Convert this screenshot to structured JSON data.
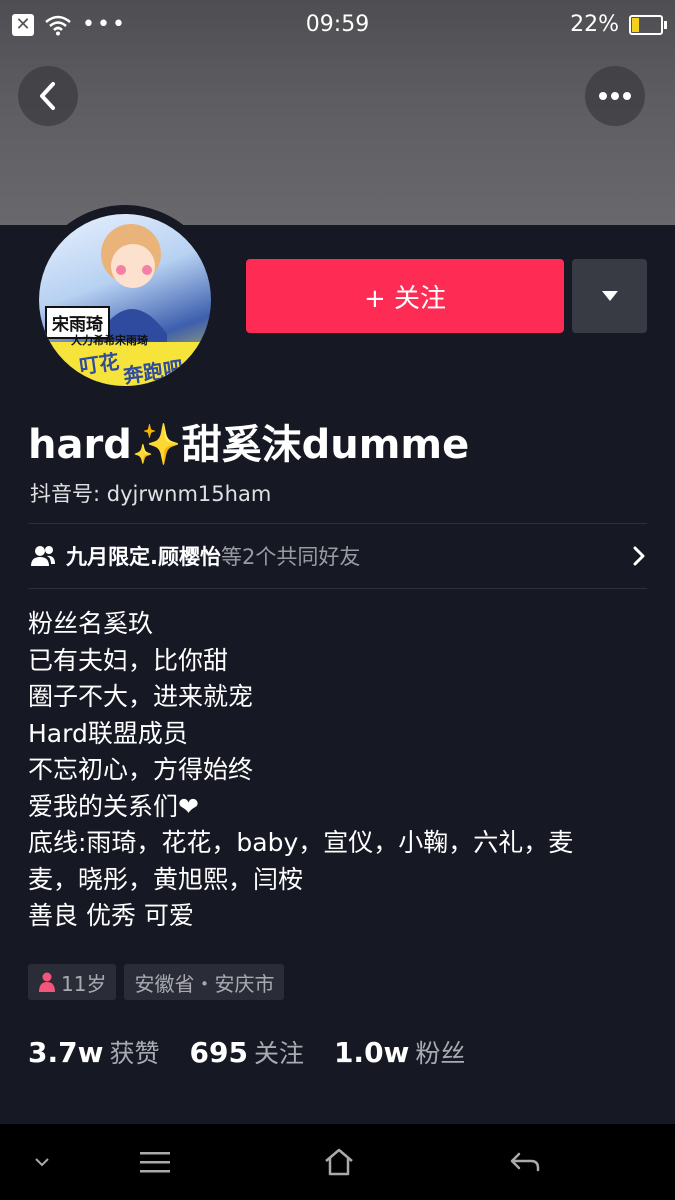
{
  "status_bar": {
    "time": "09:59",
    "battery": "22%",
    "dots": "•••"
  },
  "header": {
    "back_icon": "chevron-left-icon",
    "more_icon": "more-horizontal-icon"
  },
  "avatar": {
    "name_badge": "宋雨琦",
    "slogan_top": "大力希希宋雨琦",
    "slogan_bottom": "奔跑吧",
    "slogan_left": "叮花"
  },
  "actions": {
    "follow_label": "+ 关注",
    "dropdown_icon": "caret-down-icon"
  },
  "profile": {
    "username": "hard✨甜奚沫dumme",
    "douyin_id": "抖音号: dyjrwnm15ham"
  },
  "friends": {
    "name": "九月限定.顾樱怡",
    "suffix": "等2个共同好友"
  },
  "bio": [
    "粉丝名奚玖",
    "已有夫妇，比你甜",
    "圈子不大，进来就宠",
    "Hard联盟成员",
    "不忘初心，方得始终",
    "爱我的关系们❤",
    "底线:雨琦，花花，baby，宣仪，小鞠，六礼，麦",
    "麦，晓彤，黄旭熙，闫桉",
    "善良  优秀  可爱"
  ],
  "tags": {
    "age": "11岁",
    "location": "安徽省・安庆市"
  },
  "stats": [
    {
      "num": "3.7w",
      "label": "获赞"
    },
    {
      "num": "695",
      "label": "关注"
    },
    {
      "num": "1.0w",
      "label": "粉丝"
    }
  ],
  "colors": {
    "background": "#161823",
    "accent": "#fe2c55",
    "muted_text": "#a9aab1"
  }
}
